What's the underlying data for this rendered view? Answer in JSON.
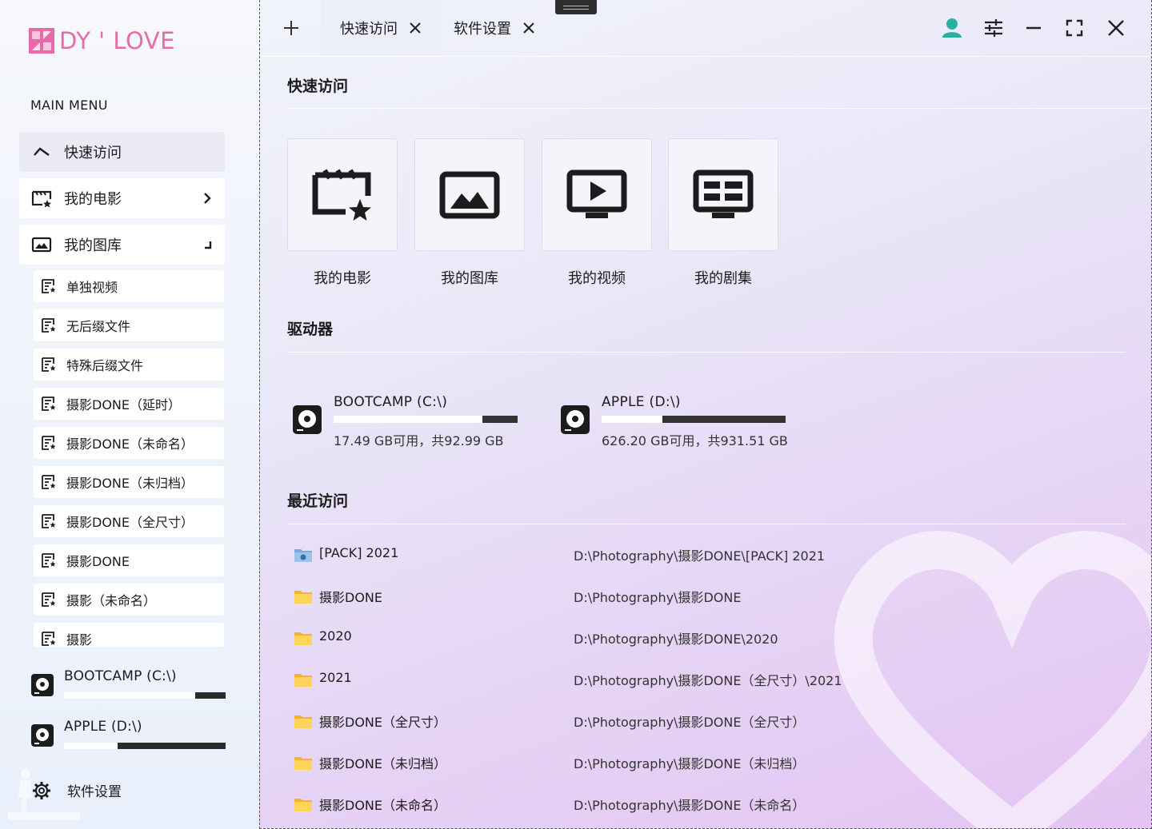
{
  "logo": {
    "text": "DY ' LOVE",
    "accent": "#e86aa8"
  },
  "sidebar": {
    "menu_title": "MAIN MENU",
    "items": [
      {
        "label": "快速访问",
        "icon": "chevron-up-icon",
        "state": "active"
      },
      {
        "label": "我的电影",
        "icon": "movie-star-icon",
        "right_icon": "chevron-right-icon"
      },
      {
        "label": "我的图库",
        "icon": "image-icon",
        "right_icon": "corner-arrow-icon"
      }
    ],
    "sub_items": [
      {
        "label": "单独视频"
      },
      {
        "label": "无后缀文件"
      },
      {
        "label": "特殊后缀文件"
      },
      {
        "label": "摄影DONE（延时）"
      },
      {
        "label": "摄影DONE（未命名）"
      },
      {
        "label": "摄影DONE（未归档）"
      },
      {
        "label": "摄影DONE（全尺寸）"
      },
      {
        "label": "摄影DONE"
      },
      {
        "label": "摄影（未命名）"
      },
      {
        "label": "摄影"
      }
    ],
    "drives": [
      {
        "label": "BOOTCAMP (C:\\)",
        "used_fraction": 0.19
      },
      {
        "label": "APPLE (D:\\)",
        "used_fraction": 0.67
      }
    ],
    "settings_label": "软件设置"
  },
  "tabs": [
    {
      "label": "快速访问",
      "active": true
    },
    {
      "label": "软件设置",
      "active": false
    }
  ],
  "titlebar": {
    "icons": [
      "user-avatar-icon",
      "sliders-icon",
      "minimize-icon",
      "fullscreen-icon",
      "close-icon"
    ]
  },
  "quick_access": {
    "title": "快速访问",
    "cards": [
      {
        "label": "我的电影",
        "icon": "movie-star-icon"
      },
      {
        "label": "我的图库",
        "icon": "image-icon"
      },
      {
        "label": "我的视频",
        "icon": "tv-play-icon"
      },
      {
        "label": "我的剧集",
        "icon": "news-icon"
      }
    ]
  },
  "drives_section": {
    "title": "驱动器",
    "drives": [
      {
        "name": "BOOTCAMP (C:\\)",
        "info": "17.49 GB可用，共92.99 GB",
        "used_fraction": 0.19
      },
      {
        "name": "APPLE (D:\\)",
        "info": "626.20 GB可用，共931.51 GB",
        "used_fraction": 0.67
      }
    ]
  },
  "recent": {
    "title": "最近访问",
    "rows": [
      {
        "name": "[PACK] 2021",
        "path": "D:\\Photography\\摄影DONE\\[PACK] 2021",
        "icon": "special-folder-icon"
      },
      {
        "name": "摄影DONE",
        "path": "D:\\Photography\\摄影DONE",
        "icon": "folder-icon"
      },
      {
        "name": "2020",
        "path": "D:\\Photography\\摄影DONE\\2020",
        "icon": "folder-icon"
      },
      {
        "name": "2021",
        "path": "D:\\Photography\\摄影DONE（全尺寸）\\2021",
        "icon": "folder-icon"
      },
      {
        "name": "摄影DONE（全尺寸）",
        "path": "D:\\Photography\\摄影DONE（全尺寸）",
        "icon": "folder-icon"
      },
      {
        "name": "摄影DONE（未归档）",
        "path": "D:\\Photography\\摄影DONE（未归档）",
        "icon": "folder-icon"
      },
      {
        "name": "摄影DONE（未命名）",
        "path": "D:\\Photography\\摄影DONE（未命名）",
        "icon": "folder-icon"
      }
    ]
  },
  "colors": {
    "folder": "#ffc83d",
    "bar_fill": "#2b2b2b",
    "avatar": "#27b1a3"
  }
}
